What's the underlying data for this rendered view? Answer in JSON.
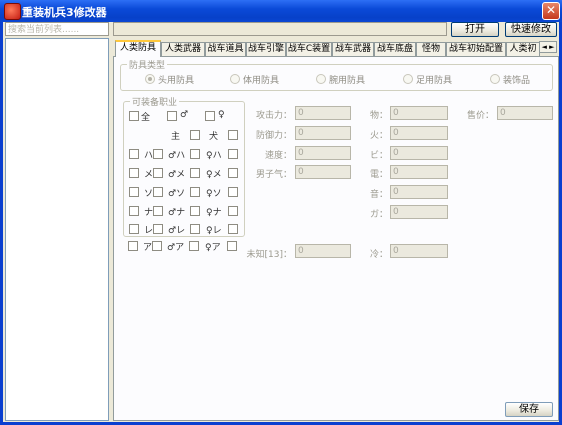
{
  "window": {
    "title": "重装机兵3修改器",
    "close_glyph": "✕"
  },
  "left": {
    "search_placeholder": "搜索当前列表......"
  },
  "toolbar": {
    "open_label": "打开",
    "quick_label": "快速修改"
  },
  "tabs": [
    "人类防具",
    "人类武器",
    "战车道具",
    "战车引擎",
    "战车C装置",
    "战车武器",
    "战车底盘",
    "怪物",
    "战车初始配置",
    "人类初"
  ],
  "tab_spinner": "◄ ►",
  "armor_type": {
    "title": "防具类型",
    "options": [
      "头用防具",
      "体用防具",
      "腕用防具",
      "足用防具",
      "装饰品"
    ],
    "selected": 0
  },
  "equip_class": {
    "title": "可装备职业",
    "all": "全",
    "male_sym": "♂",
    "female_sym": "♀",
    "master": "主",
    "dog": "犬",
    "rows": [
      [
        "ハ",
        "♂ハ",
        "♀ハ"
      ],
      [
        "メ",
        "♂メ",
        "♀メ"
      ],
      [
        "ソ",
        "♂ソ",
        "♀ソ"
      ],
      [
        "ナ",
        "♂ナ",
        "♀ナ"
      ],
      [
        "レ",
        "♂レ",
        "♀レ"
      ],
      [
        "ア",
        "♂ア",
        "♀ア"
      ]
    ]
  },
  "stats": {
    "col1": [
      {
        "label": "攻击力：",
        "value": "0"
      },
      {
        "label": "防御力：",
        "value": "0"
      },
      {
        "label": "速度：",
        "value": "0"
      },
      {
        "label": "男子气：",
        "value": "0"
      }
    ],
    "unknown": {
      "label": "未知[13]：",
      "value": "0"
    },
    "col2": [
      {
        "label": "物：",
        "value": "0"
      },
      {
        "label": "火：",
        "value": "0"
      },
      {
        "label": "ビ：",
        "value": "0"
      },
      {
        "label": "電：",
        "value": "0"
      },
      {
        "label": "音：",
        "value": "0"
      },
      {
        "label": "ガ：",
        "value": "0"
      },
      {
        "label": "冷：",
        "value": "0"
      }
    ],
    "price": {
      "label": "售价：",
      "value": "0"
    }
  },
  "save_label": "保存"
}
